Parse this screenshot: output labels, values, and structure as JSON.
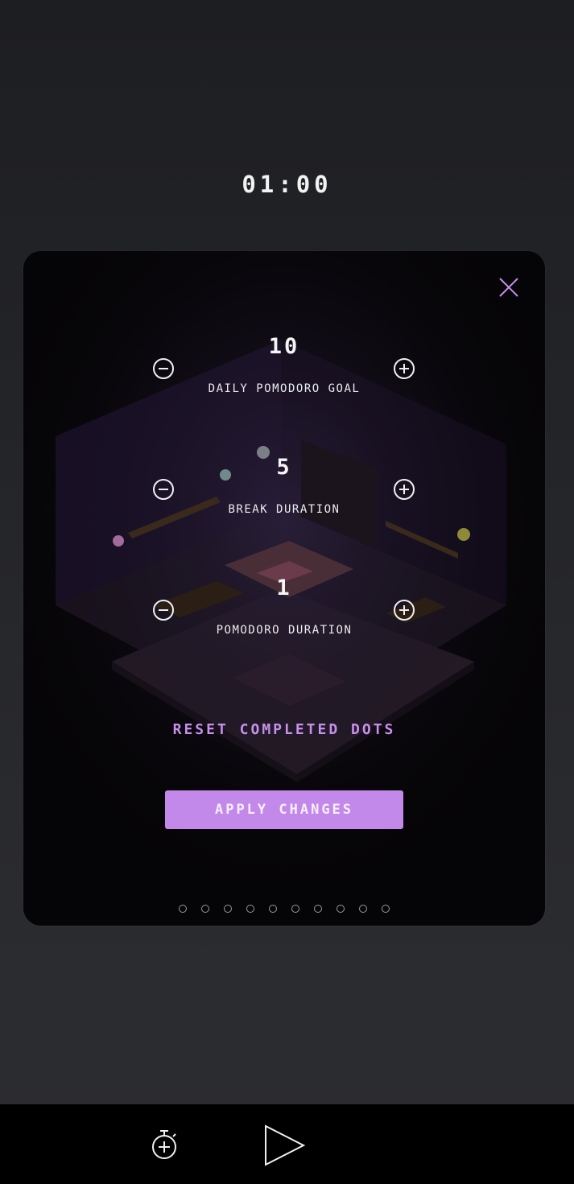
{
  "timer": {
    "display": "01:00"
  },
  "settings_modal": {
    "close_icon": "close-icon",
    "settings": [
      {
        "value": "10",
        "label": "DAILY POMODORO GOAL"
      },
      {
        "value": "5",
        "label": "BREAK DURATION"
      },
      {
        "value": "1",
        "label": "POMODORO DURATION"
      }
    ],
    "reset_label": "RESET COMPLETED DOTS",
    "apply_label": "APPLY CHANGES",
    "progress_dots": {
      "total": 10,
      "completed": 0
    }
  },
  "bottom_bar": {
    "add_timer_icon": "stopwatch-plus-icon",
    "play_icon": "play-icon"
  },
  "colors": {
    "accent": "#c389ea",
    "accent_text": "#c690ec",
    "modal_bg": "#050406",
    "page_bg": "#25262a",
    "bottom_bar": "#000000"
  }
}
